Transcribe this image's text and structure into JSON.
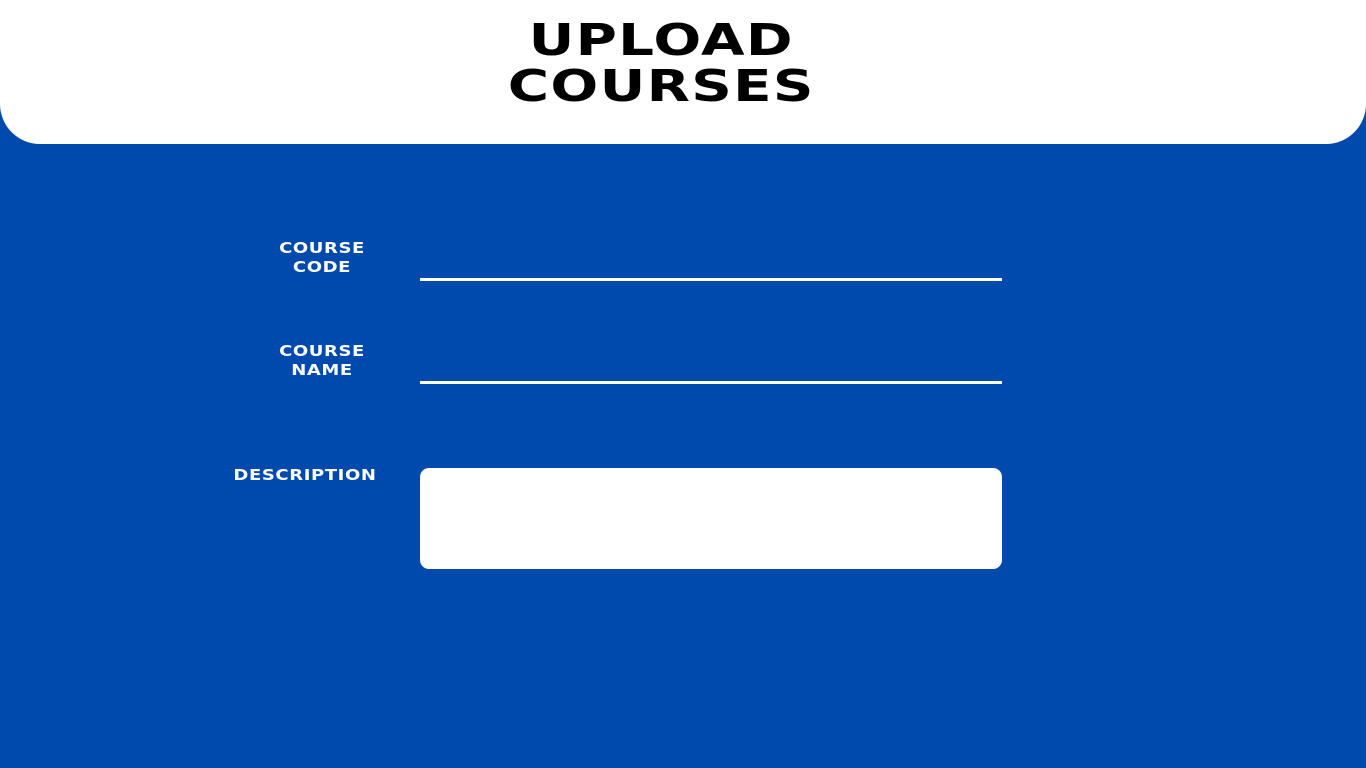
{
  "header": {
    "title_line1": "UPLOAD",
    "title_line2": "COURSES"
  },
  "form": {
    "course_code": {
      "label_line1": "COURSE",
      "label_line2": "CODE",
      "value": ""
    },
    "course_name": {
      "label_line1": "COURSE",
      "label_line2": "NAME",
      "value": ""
    },
    "description": {
      "label": "DESCRIPTION",
      "value": ""
    }
  },
  "colors": {
    "background": "#004aad",
    "header_background": "#ffffff",
    "title_text": "#000000",
    "label_text": "#ffffff",
    "input_underline": "#ffffff",
    "description_box": "#ffffff"
  }
}
